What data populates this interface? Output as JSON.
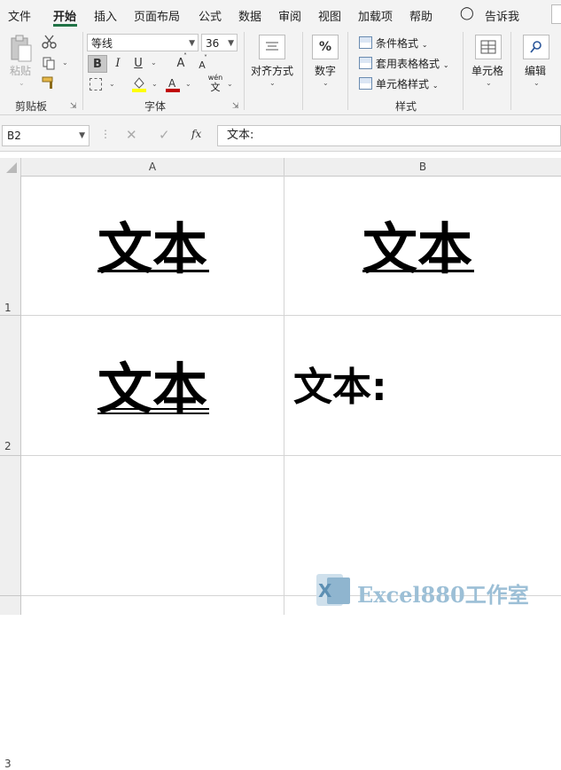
{
  "menu_tabs": [
    "文件",
    "开始",
    "插入",
    "页面布局",
    "公式",
    "数据",
    "审阅",
    "视图",
    "加载项",
    "帮助"
  ],
  "active_tab": "开始",
  "tell_me": "告诉我",
  "ribbon": {
    "clipboard": {
      "paste_label": "粘贴",
      "group_label": "剪贴板"
    },
    "font": {
      "font_name": "等线",
      "font_size": "36",
      "bold": "B",
      "italic": "I",
      "underline": "U",
      "grow": "A",
      "shrink": "A",
      "phonetic_top": "wén",
      "phonetic_bottom": "文",
      "group_label": "字体"
    },
    "alignment": {
      "label": "对齐方式"
    },
    "number": {
      "label": "数字",
      "icon_text": "%"
    },
    "styles": {
      "conditional": "条件格式",
      "table": "套用表格格式",
      "cell_styles": "单元格样式",
      "group_label": "样式"
    },
    "cells": {
      "label": "单元格"
    },
    "editing": {
      "label": "编辑"
    }
  },
  "formula_bar": {
    "name_box": "B2",
    "fx": "fx",
    "content": "文本:"
  },
  "grid": {
    "columns": [
      "A",
      "B"
    ],
    "rows": [
      "1",
      "2",
      "3"
    ],
    "cells": {
      "a1": "文本",
      "b1": "文本",
      "a2": "文本",
      "b2": "文本:"
    }
  },
  "watermark": "Excel880工作室",
  "colors": {
    "accent": "#217346",
    "font_color_bar": "#c00000",
    "highlight_bar": "#ffff00"
  }
}
